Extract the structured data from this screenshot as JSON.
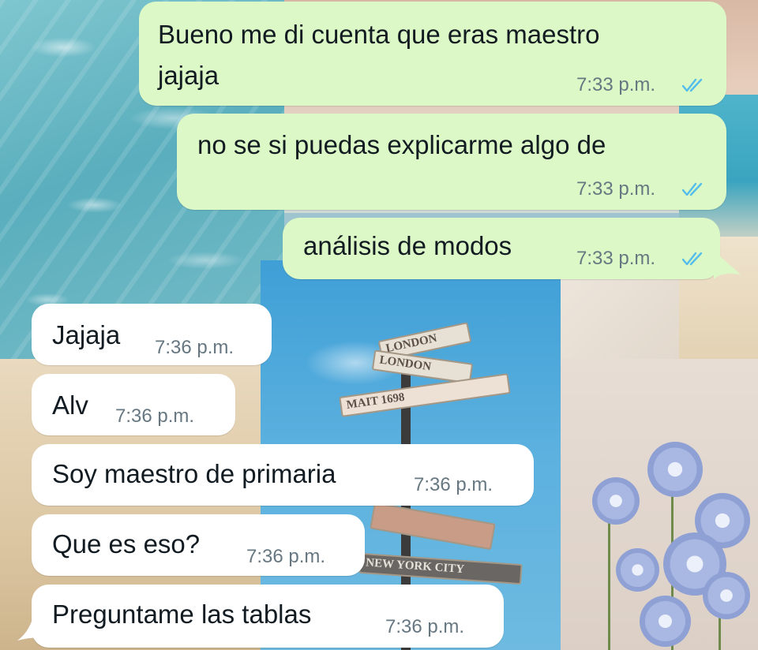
{
  "messages": [
    {
      "direction": "outgoing",
      "lines": [
        "Bueno me di cuenta que eras maestro",
        "jajaja"
      ],
      "time": "7:33 p.m.",
      "status": "read-double-check"
    },
    {
      "direction": "outgoing",
      "lines": [
        "no se si puedas explicarme algo de"
      ],
      "time": "7:33 p.m.",
      "status": "read-double-check"
    },
    {
      "direction": "outgoing",
      "lines": [
        "análisis de modos"
      ],
      "time": "7:33 p.m.",
      "status": "read-double-check"
    },
    {
      "direction": "incoming",
      "lines": [
        "Jajaja"
      ],
      "time": "7:36 p.m."
    },
    {
      "direction": "incoming",
      "lines": [
        "Alv"
      ],
      "time": "7:36 p.m."
    },
    {
      "direction": "incoming",
      "lines": [
        "Soy maestro de primaria"
      ],
      "time": "7:36 p.m."
    },
    {
      "direction": "incoming",
      "lines": [
        "Que es eso?"
      ],
      "time": "7:36 p.m."
    },
    {
      "direction": "incoming",
      "lines": [
        "Preguntame las tablas"
      ],
      "time": "7:36 p.m."
    }
  ],
  "wallpaper": {
    "signs": [
      "LONDON",
      "LONDON",
      "MAIT 1698",
      "",
      "NEW YORK CITY"
    ]
  },
  "colors": {
    "outgoing_bubble": "#dcf8c6",
    "incoming_bubble": "#ffffff",
    "read_ticks": "#53bdeb",
    "timestamp": "#667781"
  }
}
